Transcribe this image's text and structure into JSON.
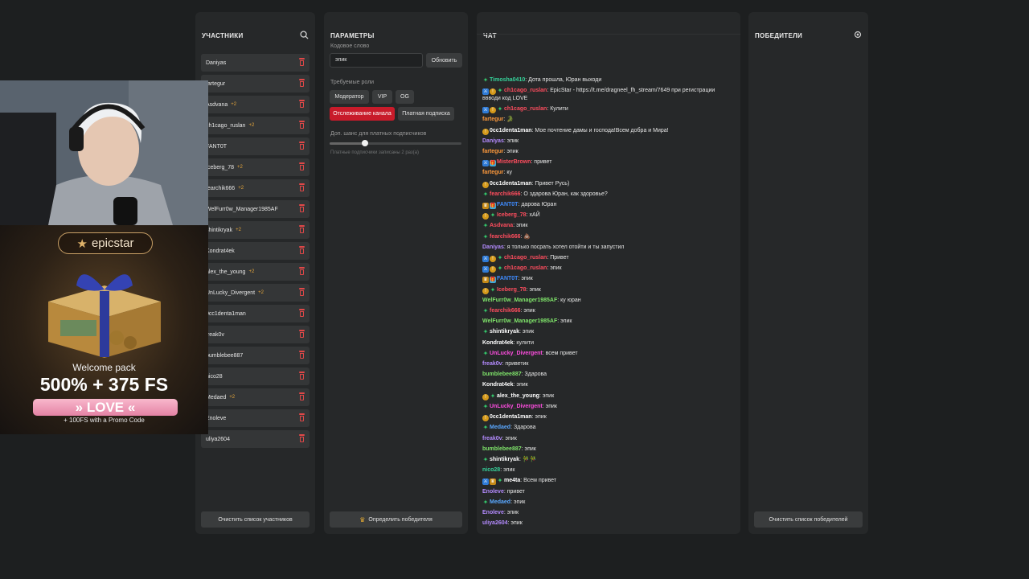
{
  "participants": {
    "title": "УЧАСТНИКИ",
    "items": [
      {
        "name": "Daniyas",
        "bonus": ""
      },
      {
        "name": "fartegur",
        "bonus": ""
      },
      {
        "name": "Asdvana",
        "bonus": "+2"
      },
      {
        "name": "ch1cago_ruslan",
        "bonus": "+2"
      },
      {
        "name": "FANT0T",
        "bonus": ""
      },
      {
        "name": "Iceberg_78",
        "bonus": "+2"
      },
      {
        "name": "fearchik666",
        "bonus": "+2"
      },
      {
        "name": "WelFurr0w_Manager1985AF",
        "bonus": ""
      },
      {
        "name": "shintikryak",
        "bonus": "+2"
      },
      {
        "name": "Kondrat4ek",
        "bonus": ""
      },
      {
        "name": "alex_the_young",
        "bonus": "+2"
      },
      {
        "name": "UnLucky_Divergent",
        "bonus": "+2"
      },
      {
        "name": "0cc1denta1man",
        "bonus": ""
      },
      {
        "name": "freak0v",
        "bonus": ""
      },
      {
        "name": "bumblebee887",
        "bonus": ""
      },
      {
        "name": "nico28",
        "bonus": ""
      },
      {
        "name": "Medaed",
        "bonus": "+2"
      },
      {
        "name": "Enoleve",
        "bonus": ""
      },
      {
        "name": "uliya2604",
        "bonus": ""
      }
    ],
    "clear_label": "Очистить список участников"
  },
  "params": {
    "title": "ПАРАМЕТРЫ",
    "keyword_label": "Кодовое слово",
    "keyword_value": "эпик",
    "update_label": "Обновить",
    "roles_label": "Требуемые роли",
    "roles": [
      "Модератор",
      "VIP",
      "OG"
    ],
    "roles2": [
      "Отслеживание канала",
      "Платная подписка"
    ],
    "bonus_label": "Доп. шанс для платных подписчиков",
    "bonus_level": 0.27,
    "bonus_note": "Платные подписчики записаны 2 раз(а)",
    "pick_label": "Определить победителя"
  },
  "chat": {
    "title": "ЧАТ",
    "messages": [
      {
        "badges": [
          "green"
        ],
        "user": "Timosha0410",
        "color": "#36d39b",
        "text": "Дота прошла, Юран выходи"
      },
      {
        "badges": [
          "blue",
          "gold",
          "green"
        ],
        "user": "ch1cago_ruslan",
        "color": "#ff4d5e",
        "text": "EpicStar - https://t.me/dragneel_fh_stream/7649 при регистрации ввводи код LOVE",
        "wrap": true
      },
      {
        "badges": [
          "blue",
          "gold",
          "green"
        ],
        "user": "ch1cago_ruslan",
        "color": "#ff4d5e",
        "text": "Кулити"
      },
      {
        "badges": [],
        "user": "fartegur",
        "color": "#ff9a3c",
        "text": "🐊"
      },
      {
        "badges": [
          "gold"
        ],
        "user": "0cc1denta1man",
        "color": "#ffffff",
        "text": "Мое почтение дамы и господа!Всем добра и Мира!"
      },
      {
        "badges": [],
        "user": "Daniyas",
        "color": "#b48bff",
        "text": "эпик"
      },
      {
        "badges": [],
        "user": "fartegur",
        "color": "#ff9a3c",
        "text": "эпик"
      },
      {
        "badges": [
          "blue",
          "gift"
        ],
        "user": "MisterBrown",
        "color": "#ff4d5e",
        "text": "привет"
      },
      {
        "badges": [],
        "user": "fartegur",
        "color": "#ff9a3c",
        "text": "ку"
      },
      {
        "badges": [
          "gold"
        ],
        "user": "0cc1denta1man",
        "color": "#ffffff",
        "text": "Привет Русь)"
      },
      {
        "badges": [
          "green"
        ],
        "user": "fearchik666",
        "color": "#ff4d5e",
        "text": "О здарова Юран, как здоровье?"
      },
      {
        "badges": [
          "crown",
          "gift"
        ],
        "user": "FANT0T",
        "color": "#3f8cff",
        "text": "дарова Юран"
      },
      {
        "badges": [
          "gold",
          "green"
        ],
        "user": "Iceberg_78",
        "color": "#ff4d5e",
        "text": "хАЙ"
      },
      {
        "badges": [
          "green"
        ],
        "user": "Asdvana",
        "color": "#ff4d5e",
        "text": "эпик"
      },
      {
        "badges": [
          "green"
        ],
        "user": "fearchik666",
        "color": "#ff4d5e",
        "text": "💩"
      },
      {
        "badges": [],
        "user": "Daniyas",
        "color": "#b48bff",
        "text": "я только посрать хотел отойти и ты запустил"
      },
      {
        "badges": [
          "blue",
          "gold",
          "green"
        ],
        "user": "ch1cago_ruslan",
        "color": "#ff4d5e",
        "text": "Привет"
      },
      {
        "badges": [
          "blue",
          "gold",
          "green"
        ],
        "user": "ch1cago_ruslan",
        "color": "#ff4d5e",
        "text": "эпик"
      },
      {
        "badges": [
          "crown",
          "gift"
        ],
        "user": "FANT0T",
        "color": "#3f8cff",
        "text": "эпик"
      },
      {
        "badges": [
          "gold",
          "green"
        ],
        "user": "Iceberg_78",
        "color": "#ff4d5e",
        "text": "эпик"
      },
      {
        "badges": [],
        "user": "WelFurr0w_Manager1985AF",
        "color": "#7fe36a",
        "text": "ку юран"
      },
      {
        "badges": [
          "green"
        ],
        "user": "fearchik666",
        "color": "#ff4d5e",
        "text": "эпик"
      },
      {
        "badges": [],
        "user": "WelFurr0w_Manager1985AF",
        "color": "#7fe36a",
        "text": "эпик"
      },
      {
        "badges": [
          "green"
        ],
        "user": "shintikryak",
        "color": "#ffffff",
        "text": "эпик"
      },
      {
        "badges": [],
        "user": "Kondrat4ek",
        "color": "#ffffff",
        "text": "кулити"
      },
      {
        "badges": [
          "green"
        ],
        "user": "UnLucky_Divergent",
        "color": "#ff4de0",
        "text": "всем привет"
      },
      {
        "badges": [],
        "user": "freak0v",
        "color": "#b48bff",
        "text": "приветик"
      },
      {
        "badges": [],
        "user": "bumblebee887",
        "color": "#7fe36a",
        "text": "Здарова"
      },
      {
        "badges": [],
        "user": "Kondrat4ek",
        "color": "#ffffff",
        "text": "эпик"
      },
      {
        "badges": [
          "gold",
          "green"
        ],
        "user": "alex_the_young",
        "color": "#ffffff",
        "text": "эпик"
      },
      {
        "badges": [
          "green"
        ],
        "user": "UnLucky_Divergent",
        "color": "#ff4de0",
        "text": "эпик"
      },
      {
        "badges": [
          "gold"
        ],
        "user": "0cc1denta1man",
        "color": "#ffffff",
        "text": "эпик"
      },
      {
        "badges": [
          "green"
        ],
        "user": "Medaed",
        "color": "#5aa8ff",
        "text": "Здарова"
      },
      {
        "badges": [],
        "user": "freak0v",
        "color": "#b48bff",
        "text": "эпик"
      },
      {
        "badges": [],
        "user": "bumblebee887",
        "color": "#7fe36a",
        "text": "эпик"
      },
      {
        "badges": [
          "green"
        ],
        "user": "shintikryak",
        "color": "#ffffff",
        "text": "🎋🎋"
      },
      {
        "badges": [],
        "user": "nico28",
        "color": "#36d39b",
        "text": "эпик"
      },
      {
        "badges": [
          "blue",
          "crown",
          "green"
        ],
        "user": "me4ta",
        "color": "#ffffff",
        "text": "Всем привет"
      },
      {
        "badges": [],
        "user": "Enoleve",
        "color": "#b48bff",
        "text": "привет"
      },
      {
        "badges": [
          "green"
        ],
        "user": "Medaed",
        "color": "#5aa8ff",
        "text": "эпик"
      },
      {
        "badges": [],
        "user": "Enoleve",
        "color": "#b48bff",
        "text": "эпик"
      },
      {
        "badges": [],
        "user": "uliya2604",
        "color": "#b48bff",
        "text": "эпик"
      }
    ]
  },
  "winners": {
    "title": "ПОБЕДИТЕЛИ",
    "clear_label": "Очистить список победителей"
  },
  "ad": {
    "brand": "epicstar",
    "welcome": "Welcome pack",
    "offer": "500% + 375 FS",
    "code": "» LOVE «",
    "promo": "+ 100FS with a Promo Code"
  },
  "icons": {
    "search": "search-icon",
    "trash": "trash-icon",
    "crown": "crown-icon",
    "refresh": "refresh-icon"
  }
}
